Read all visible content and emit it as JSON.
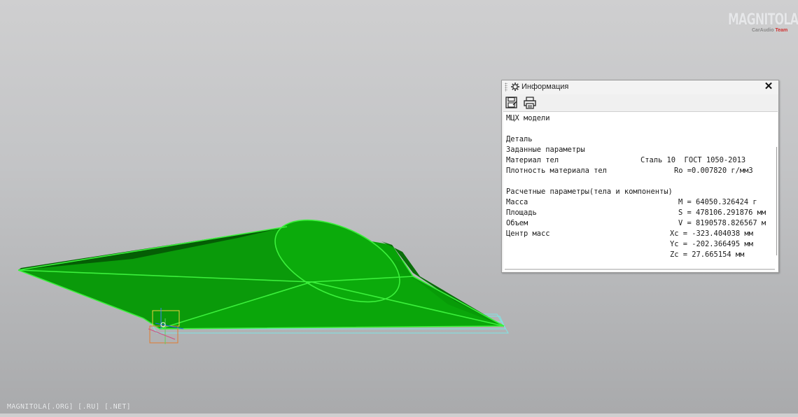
{
  "logo": {
    "brand": "MAGNITOLA",
    "sub_left": "CarAudio",
    "sub_right": "Team"
  },
  "watermark": "MAGNITOLA[.ORG] [.RU] [.NET]",
  "info_panel": {
    "title": "Информация",
    "toolbar": {
      "save_icon": "save-icon",
      "print_icon": "print-icon"
    },
    "heading": "МЦХ модели",
    "object_type": "Деталь",
    "given_params_title": "Заданные параметры",
    "material_label": "Материал тел",
    "material_value": "Сталь 10  ГОСТ 1050-2013",
    "density_label": "Плотность материала тел",
    "density_value": "Ro =0.007820 г/мм3",
    "calc_params_title": "Расчетные параметры(тела и компоненты)",
    "mass_label": "Масса",
    "mass_value": "M = 64050.326424 г",
    "area_label": "Площадь",
    "area_value": "S = 478106.291876 мм",
    "volume_label": "Объем",
    "volume_value": "V = 8190578.826567 м",
    "com_label": "Центр масс",
    "xc_value": "Xc = -323.404038 мм",
    "yc_value": "Yc = -202.366495 мм",
    "zc_value": "Zc = 27.665154 мм"
  },
  "colors": {
    "model_fill": "#06a806",
    "model_edge": "#3cf03c",
    "background": "#c8c9cb"
  }
}
